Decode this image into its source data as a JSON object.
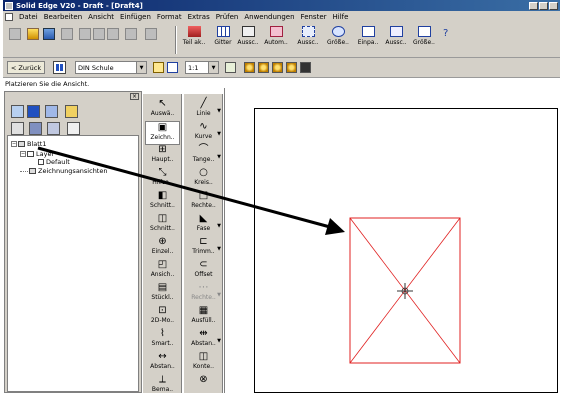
{
  "window": {
    "title": "Solid Edge V20 - Draft - [Draft4]"
  },
  "menu": [
    "Datei",
    "Bearbeiten",
    "Ansicht",
    "Einfügen",
    "Format",
    "Extras",
    "Prüfen",
    "Anwendungen",
    "Fenster",
    "Hilfe"
  ],
  "toolbar1": {
    "big_buttons": [
      "Teil ak..",
      "Gitter",
      "Aussc..",
      "Autom..",
      "Aussc..",
      "Größe..",
      "Einpa..",
      "Aussc..",
      "Größe.."
    ]
  },
  "toolbar2": {
    "back_label": "< Zurück",
    "style_select": "DIN Schule",
    "scale_select": "1:1"
  },
  "prompt": "Platzieren Sie die Ansicht.",
  "tree": {
    "sheet": "Blatt1",
    "layer_group": "Layer",
    "layer_default": "Default",
    "drawing_views": "Zeichnungsansichten"
  },
  "palette_left": [
    {
      "label": "Auswä..",
      "glyph": "↖"
    },
    {
      "label": "Zeichn..",
      "glyph": "▣"
    },
    {
      "label": "Haupt..",
      "glyph": "⊞"
    },
    {
      "label": "Hilfsa..",
      "glyph": "⤡"
    },
    {
      "label": "Schnitt..",
      "glyph": "◧"
    },
    {
      "label": "Schnitt..",
      "glyph": "◫"
    },
    {
      "label": "Einzel..",
      "glyph": "⊕"
    },
    {
      "label": "Ansich..",
      "glyph": "◰"
    },
    {
      "label": "Stückl..",
      "glyph": "▤"
    },
    {
      "label": "2D-Mo..",
      "glyph": "⊡"
    },
    {
      "label": "Smart..",
      "glyph": "⌇"
    },
    {
      "label": "Abstan..",
      "glyph": "↔"
    },
    {
      "label": "Bema..",
      "glyph": "⟂"
    }
  ],
  "palette_right": [
    {
      "label": "Linie",
      "glyph": "╱"
    },
    {
      "label": "Kurve",
      "glyph": "∿"
    },
    {
      "label": "Tange..",
      "glyph": "⌒"
    },
    {
      "label": "Kreis..",
      "glyph": "○"
    },
    {
      "label": "Rechte..",
      "glyph": "□"
    },
    {
      "label": "Fase",
      "glyph": "◣"
    },
    {
      "label": "Trimm..",
      "glyph": "⊏"
    },
    {
      "label": "Offset",
      "glyph": "⊂"
    },
    {
      "label": "Rechte..",
      "glyph": "⋯"
    },
    {
      "label": "Ausfüll..",
      "glyph": "▦"
    },
    {
      "label": "Abstan..",
      "glyph": "⇹"
    },
    {
      "label": "Konte..",
      "glyph": "◫"
    },
    {
      "label": "",
      "glyph": "⊗"
    }
  ],
  "colors": {
    "titlebar": "#0a246a",
    "view_outline": "#e02020",
    "arrow": "#000000"
  }
}
